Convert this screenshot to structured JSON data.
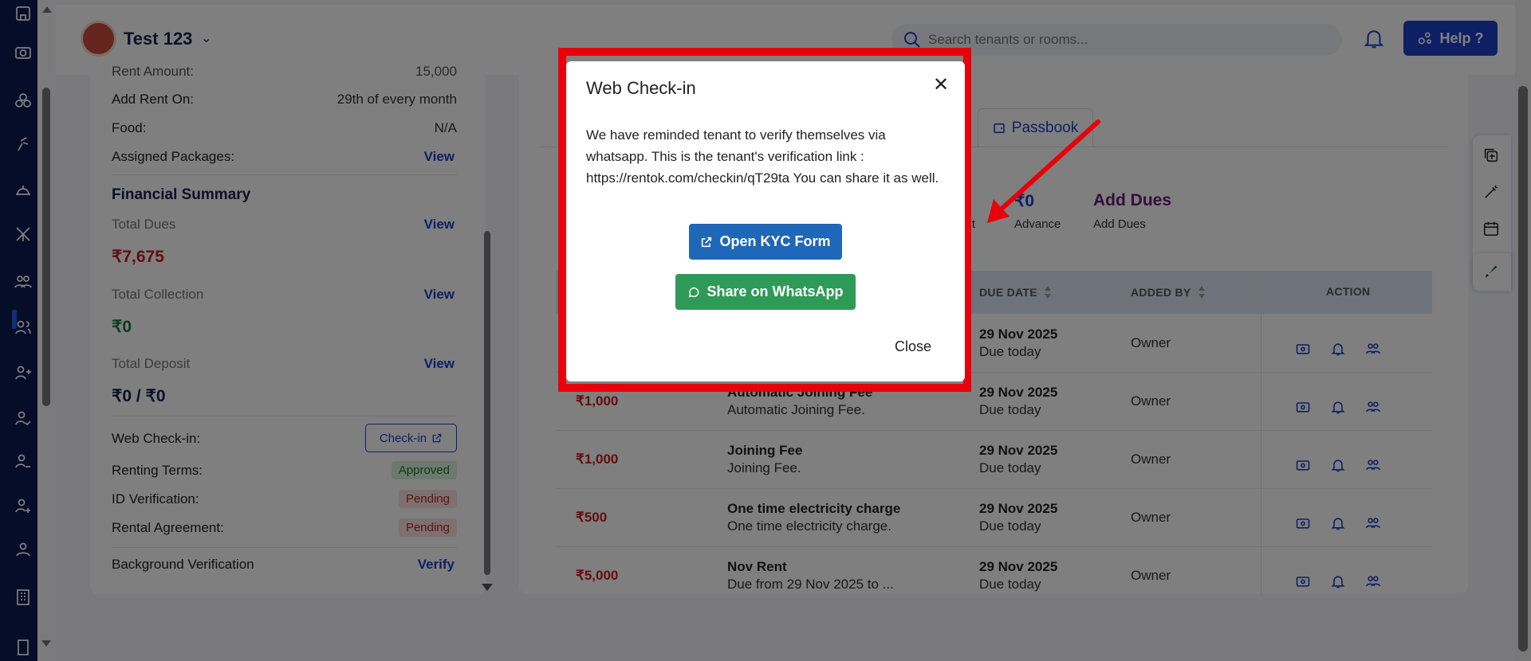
{
  "header": {
    "property_name": "Test 123",
    "search_placeholder": "Search tenants or rooms...",
    "help_label": "Help ?"
  },
  "left_panel": {
    "rent_amount_label": "Rent Amount:",
    "rent_amount_value": "15,000",
    "add_rent_on_label": "Add Rent On:",
    "add_rent_on_value": "29th of every month",
    "food_label": "Food:",
    "food_value": "N/A",
    "packages_label": "Assigned Packages:",
    "view": "View",
    "financial_summary_title": "Financial Summary",
    "total_dues_label": "Total Dues",
    "total_dues_value": "₹7,675",
    "total_collection_label": "Total Collection",
    "total_collection_value": "₹0",
    "total_deposit_label": "Total Deposit",
    "total_deposit_value": "₹0 / ₹0",
    "web_checkin_label": "Web Check-in:",
    "checkin_button": "Check-in",
    "renting_terms_label": "Renting Terms:",
    "renting_terms_status": "Approved",
    "id_verification_label": "ID Verification:",
    "id_verification_status": "Pending",
    "rental_agreement_label": "Rental Agreement:",
    "rental_agreement_status": "Pending",
    "background_label": "Background Verification",
    "verify": "Verify"
  },
  "right_panel": {
    "tab_passbook": "Passbook",
    "stat_deposit_label_partial": "sit",
    "stat_advance_value": "₹0",
    "stat_advance_label": "Advance",
    "stat_add_dues_title": "Add Dues",
    "stat_add_dues_label": "Add Dues",
    "columns": {
      "due_date": "DUE DATE",
      "added_by": "ADDED BY",
      "action": "ACTION"
    },
    "rows": [
      {
        "amount": "",
        "title": "",
        "subtitle": "",
        "date": "29 Nov 2025",
        "date_sub": "Due today",
        "added_by": "Owner"
      },
      {
        "amount": "₹1,000",
        "title": "Automatic Joining Fee",
        "subtitle": "Automatic Joining Fee.",
        "date": "29 Nov 2025",
        "date_sub": "Due today",
        "added_by": "Owner"
      },
      {
        "amount": "₹1,000",
        "title": "Joining Fee",
        "subtitle": "Joining Fee.",
        "date": "29 Nov 2025",
        "date_sub": "Due today",
        "added_by": "Owner"
      },
      {
        "amount": "₹500",
        "title": "One time electricity charge",
        "subtitle": "One time electricity charge.",
        "date": "29 Nov 2025",
        "date_sub": "Due today",
        "added_by": "Owner"
      },
      {
        "amount": "₹5,000",
        "title": "Nov Rent",
        "subtitle": "Due from 29 Nov 2025 to ...",
        "date": "29 Nov 2025",
        "date_sub": "Due today",
        "added_by": "Owner"
      }
    ]
  },
  "modal": {
    "title": "Web Check-in",
    "body": "We have reminded tenant to verify themselves via whatsapp. This is the tenant's verification link : https://rentok.com/checkin/qT29ta You can share it as well.",
    "open_kyc_label": "Open KYC Form",
    "share_whatsapp_label": "Share on WhatsApp",
    "close_label": "Close"
  },
  "colors": {
    "sidebar": "#0d1a52",
    "primary": "#1d3fc8",
    "kyc_button": "#1f67b8",
    "whatsapp_button": "#2f9a57",
    "highlight": "#e8000a",
    "due_amount": "#c81d1d"
  }
}
